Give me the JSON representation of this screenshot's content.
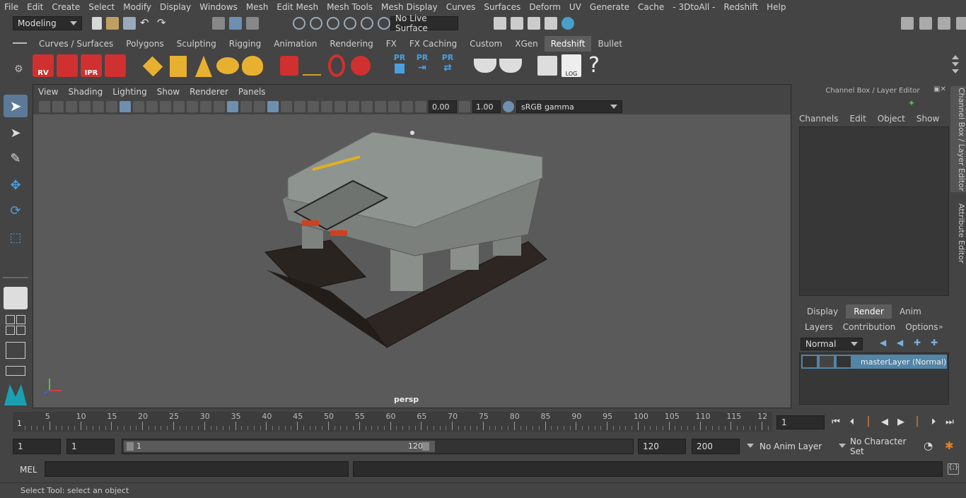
{
  "menu": [
    "File",
    "Edit",
    "Create",
    "Select",
    "Modify",
    "Display",
    "Windows",
    "Mesh",
    "Edit Mesh",
    "Mesh Tools",
    "Mesh Display",
    "Curves",
    "Surfaces",
    "Deform",
    "UV",
    "Generate",
    "Cache",
    "- 3DtoAll -",
    "Redshift",
    "Help"
  ],
  "workspace_mode": "Modeling",
  "live_surface": "No Live Surface",
  "shelf_tabs": [
    "Curves / Surfaces",
    "Polygons",
    "Sculpting",
    "Rigging",
    "Animation",
    "Rendering",
    "FX",
    "FX Caching",
    "Custom",
    "XGen",
    "Redshift",
    "Bullet"
  ],
  "active_shelf_tab": "Redshift",
  "shelf_labels": {
    "rv": "RV",
    "ipr": "IPR",
    "pr1": "PR",
    "pr2": "PR",
    "pr3": "PR",
    "log": "LOG",
    "help": "?"
  },
  "viewport_menu": [
    "View",
    "Shading",
    "Lighting",
    "Show",
    "Renderer",
    "Panels"
  ],
  "viewport": {
    "exposure": "0.00",
    "gamma": "1.00",
    "color_space": "sRGB gamma",
    "camera": "persp"
  },
  "channel_box": {
    "title": "Channel Box / Layer Editor",
    "menu": [
      "Channels",
      "Edit",
      "Object",
      "Show"
    ]
  },
  "layer_editor": {
    "tabs": [
      "Display",
      "Render",
      "Anim"
    ],
    "active_tab": "Render",
    "menu": [
      "Layers",
      "Contribution",
      "Options"
    ],
    "blend_mode": "Normal",
    "layer_name": "masterLayer (Normal)"
  },
  "side_tabs": [
    "Channel Box / Layer Editor",
    "Attribute Editor"
  ],
  "timeline": {
    "ticks": [
      "5",
      "10",
      "15",
      "20",
      "25",
      "30",
      "35",
      "40",
      "45",
      "50",
      "55",
      "60",
      "65",
      "70",
      "75",
      "80",
      "85",
      "90",
      "95",
      "100",
      "105",
      "110",
      "115",
      "12"
    ],
    "start": "1",
    "current_frame": "1"
  },
  "range": {
    "start": "1",
    "start2": "1",
    "slider_start": "1",
    "slider_end": "120",
    "end": "120",
    "total_end": "200",
    "anim_layer": "No Anim Layer",
    "character_set": "No Character Set"
  },
  "command": {
    "label": "MEL"
  },
  "status": "Select Tool: select an object"
}
